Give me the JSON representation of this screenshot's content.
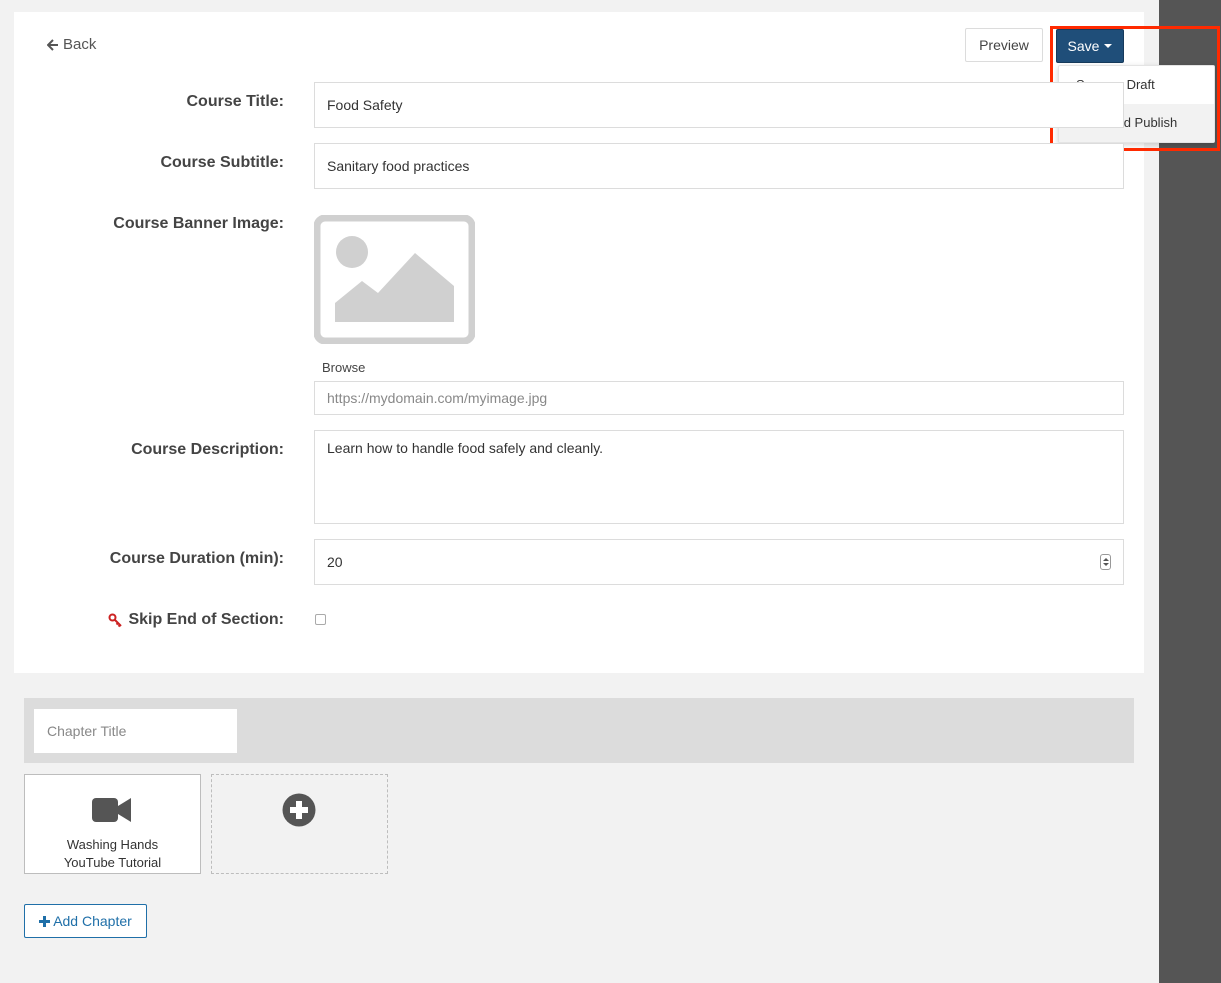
{
  "header": {
    "back_label": "Back",
    "preview_label": "Preview",
    "save_label": "Save"
  },
  "save_menu": {
    "items": [
      "Save as Draft",
      "Save and Publish"
    ],
    "hovered_item": "Save and Publish"
  },
  "form": {
    "title_label": "Course Title:",
    "title_value": "Food Safety",
    "subtitle_label": "Course Subtitle:",
    "subtitle_value": "Sanitary food practices",
    "banner_label": "Course Banner Image:",
    "browse_label": "Browse",
    "banner_url_placeholder": "https://mydomain.com/myimage.jpg",
    "description_label": "Course Description:",
    "description_value": "Learn how to handle food safely and cleanly.",
    "duration_label": "Course Duration (min):",
    "duration_value": "20",
    "skip_label": "Skip End of Section:",
    "skip_checked": false
  },
  "chapter": {
    "title_placeholder": "Chapter Title",
    "items": [
      {
        "title_line1": "Washing Hands",
        "title_line2": "YouTube Tutorial",
        "icon": "video-camera-icon"
      }
    ],
    "add_chapter_label": "Add Chapter"
  },
  "colors": {
    "primary": "#1f4e79",
    "link_blue": "#1f6fa8",
    "highlight": "#ff2a00",
    "key_icon": "#cc2222",
    "right_rail": "#555555"
  }
}
